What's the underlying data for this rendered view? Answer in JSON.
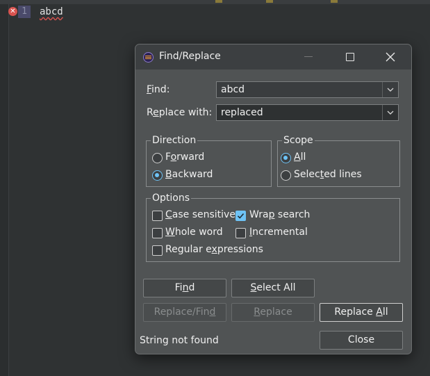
{
  "editor": {
    "line_number": "1",
    "code_text": "abcd"
  },
  "dialog": {
    "title": "Find/Replace",
    "find": {
      "label_pre": "",
      "label_key": "F",
      "label_post": "ind:",
      "value": "abcd"
    },
    "replace_with": {
      "label_pre": "R",
      "label_key": "e",
      "label_post": "place with:",
      "value": "replaced"
    },
    "direction": {
      "legend": "Direction",
      "forward": {
        "pre": "F",
        "key": "o",
        "post": "rward",
        "selected": false
      },
      "backward": {
        "pre": "",
        "key": "B",
        "post": "ackward",
        "selected": true
      }
    },
    "scope": {
      "legend": "Scope",
      "all": {
        "pre": "",
        "key": "A",
        "post": "ll",
        "selected": true
      },
      "selected_lines": {
        "pre": "Selec",
        "key": "t",
        "post": "ed lines",
        "selected": false
      }
    },
    "options": {
      "legend": "Options",
      "case_sensitive": {
        "pre": "",
        "key": "C",
        "post": "ase sensitive",
        "checked": false
      },
      "wrap_search": {
        "pre": "Wra",
        "key": "p",
        "post": " search",
        "checked": true
      },
      "whole_word": {
        "pre": "",
        "key": "W",
        "post": "hole word",
        "checked": false
      },
      "incremental": {
        "pre": "",
        "key": "I",
        "post": "ncremental",
        "checked": false
      },
      "regular_expressions": {
        "pre": "Regular e",
        "key": "x",
        "post": "pressions",
        "checked": false
      }
    },
    "buttons": {
      "find": {
        "pre": "Fi",
        "key": "n",
        "post": "d"
      },
      "select_all": {
        "pre": "",
        "key": "S",
        "post": "elect All"
      },
      "replace_find": {
        "pre": "Replace/Fin",
        "key": "d",
        "post": ""
      },
      "replace": {
        "pre": "",
        "key": "R",
        "post": "eplace"
      },
      "replace_all": {
        "pre": "Replace ",
        "key": "A",
        "post": "ll"
      },
      "close": "Close"
    },
    "status": "String not found"
  },
  "colors": {
    "accent": "#6ec3f6",
    "error": "#d9534f",
    "dialog_bg": "#505354"
  }
}
